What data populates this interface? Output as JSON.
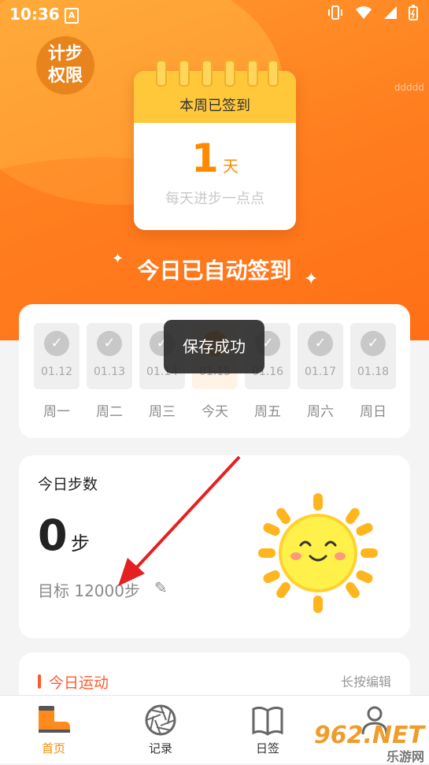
{
  "status_bar": {
    "time": "10:36",
    "app_badge": "A"
  },
  "header": {
    "permission_button": "计步\n权限",
    "corner_text": "ddddd",
    "calendar_title": "本周已签到",
    "signed_days": "1",
    "signed_unit": "天",
    "slogan": "每天进步一点点",
    "auto_signed": "今日已自动签到"
  },
  "week": {
    "days": [
      {
        "date": "01.12",
        "label": "周一",
        "checked": true
      },
      {
        "date": "01.13",
        "label": "周二",
        "checked": true
      },
      {
        "date": "01.14",
        "label": "周三",
        "checked": true
      },
      {
        "date": "01.15",
        "label": "今天",
        "checked": true
      },
      {
        "date": "01.16",
        "label": "周五",
        "checked": true
      },
      {
        "date": "01.17",
        "label": "周六",
        "checked": true
      },
      {
        "date": "01.18",
        "label": "周日",
        "checked": true
      }
    ]
  },
  "toast": "保存成功",
  "steps": {
    "title": "今日步数",
    "count": "0",
    "unit": "步",
    "goal": "目标 12000步"
  },
  "sport": {
    "title": "今日运动",
    "edit": "长按编辑"
  },
  "nav": [
    {
      "label": "首页",
      "icon": "boot-icon",
      "active": true
    },
    {
      "label": "记录",
      "icon": "aperture-icon",
      "active": false
    },
    {
      "label": "日签",
      "icon": "book-icon",
      "active": false
    },
    {
      "label": "我的",
      "icon": "user-icon",
      "active": false
    }
  ],
  "watermark": {
    "brand": "962.NET",
    "sub": "乐游网"
  },
  "colors": {
    "accent": "#ff8a00",
    "hero": "#ff7d1e",
    "calendar_head": "#ffc73a",
    "sport_accent": "#ff5a2c"
  }
}
